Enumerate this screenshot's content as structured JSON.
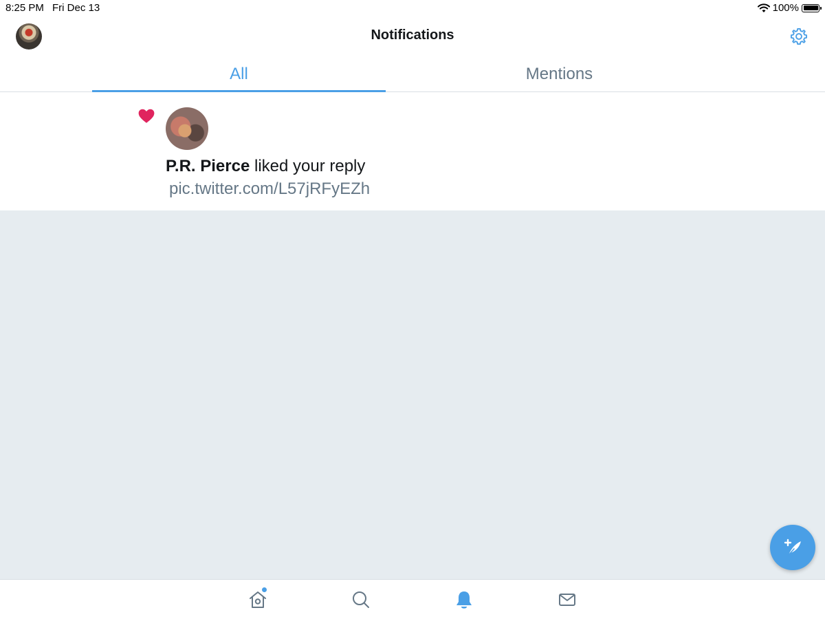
{
  "status_bar": {
    "time": "8:25 PM",
    "date": "Fri Dec 13",
    "battery": "100%",
    "battery_level": 1.0
  },
  "header": {
    "title": "Notifications",
    "avatar_icon": "profile-avatar",
    "settings_icon": "gear-icon"
  },
  "tabs": [
    {
      "label": "All",
      "selected": true
    },
    {
      "label": "Mentions",
      "selected": false
    }
  ],
  "notifications": [
    {
      "type": "like",
      "icon": "heart-icon",
      "user_name": "P.R. Pierce",
      "action_text": " liked your reply",
      "content": "pic.twitter.com/L57jRFyEZh"
    }
  ],
  "compose_button": {
    "icon": "compose-tweet-icon"
  },
  "bottom_tabs": [
    {
      "icon": "home-icon",
      "has_indicator": true,
      "active": false
    },
    {
      "icon": "search-icon",
      "active": false
    },
    {
      "icon": "bell-icon",
      "active": true
    },
    {
      "icon": "mail-icon",
      "active": false
    }
  ],
  "colors": {
    "accent": "#4a9fe6",
    "heart": "#e0245e",
    "secondary_text": "#657786",
    "background": "#e6ecf0"
  }
}
